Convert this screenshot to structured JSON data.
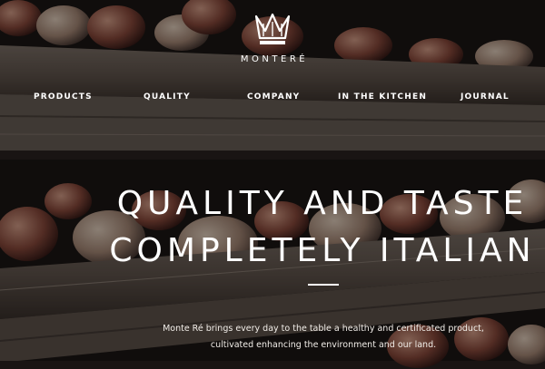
{
  "brand": {
    "name": "MONTERÉ",
    "crown_icon": "crown-icon"
  },
  "nav": {
    "items": [
      {
        "label": "PRODUCTS"
      },
      {
        "label": "QUALITY"
      },
      {
        "label": "COMPANY"
      },
      {
        "label": "IN THE KITCHEN"
      },
      {
        "label": "JOURNAL"
      }
    ]
  },
  "hero": {
    "headline_line1": "QUALITY AND TASTE",
    "headline_line2": "COMPLETELY ITALIAN",
    "subtitle_line1": "Monte Ré brings every day to the table a healthy and certificated product,",
    "subtitle_line2": "cultivated enhancing the environment and our land."
  },
  "colors": {
    "text": "#ffffff",
    "background": "#1a1412",
    "wood": "#6e6258"
  }
}
